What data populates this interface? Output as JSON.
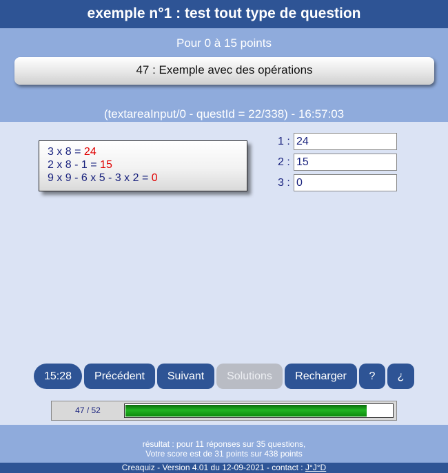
{
  "header": {
    "title": "exemple n°1 : test tout type de question",
    "points": "Pour 0 à 15 points",
    "question": "47 : Exemple avec des opérations",
    "meta": "(textareaInput/0 - questId = 22/338) - 16:57:03"
  },
  "calc": {
    "lines": [
      {
        "expr": "3 x 8 = ",
        "result": "24"
      },
      {
        "expr": "2 x 8 - 1 = ",
        "result": "15"
      },
      {
        "expr": "9 x 9 - 6 x 5 - 3 x 2 = ",
        "result": "0"
      }
    ]
  },
  "answers": [
    {
      "label": "1 :",
      "value": "24"
    },
    {
      "label": "2 :",
      "value": "15"
    },
    {
      "label": "3 :",
      "value": "0"
    }
  ],
  "toolbar": {
    "timer": "15:28",
    "prev": "Précédent",
    "next": "Suivant",
    "solutions": "Solutions",
    "reload": "Recharger",
    "help": "?",
    "help_inv": "¿"
  },
  "progress": {
    "label": "47 / 52",
    "fraction": 0.904,
    "color": "#22b422"
  },
  "footer": {
    "result_line1": "résultat : pour 11 réponses sur 35 questions,",
    "result_line2": "Votre score est de 31 points sur 438 points",
    "credit_text": "Creaquiz - Version 4.01 du 12-09-2021 - contact : ",
    "credit_link": "J°J°D"
  },
  "colors": {
    "primary": "#2e5495",
    "band": "#8fabdc",
    "background": "#dbe3f4",
    "result_red": "#e00000"
  }
}
